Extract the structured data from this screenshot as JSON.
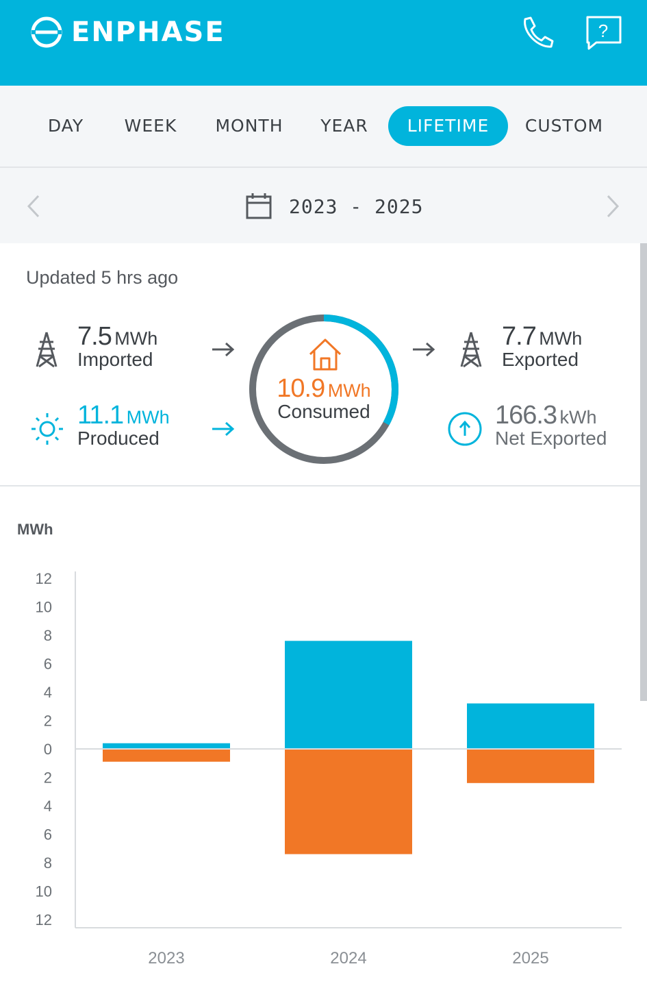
{
  "header": {
    "brand": "ENPHASE",
    "brand_color": "#01b4dc",
    "icons": [
      "enphase-logo-icon",
      "phone-icon",
      "help-icon"
    ],
    "help_glyph": "?"
  },
  "tabs": [
    {
      "label": "DAY",
      "active": false
    },
    {
      "label": "WEEK",
      "active": false
    },
    {
      "label": "MONTH",
      "active": false
    },
    {
      "label": "YEAR",
      "active": false
    },
    {
      "label": "LIFETIME",
      "active": true
    },
    {
      "label": "CUSTOM",
      "active": false
    }
  ],
  "date_range": {
    "label": "2023 - 2025",
    "icons": [
      "chevron-left-icon",
      "calendar-icon",
      "chevron-right-icon"
    ]
  },
  "summary": {
    "updated": "Updated 5 hrs ago",
    "imported": {
      "value": "7.5",
      "unit": "MWh",
      "label": "Imported"
    },
    "produced": {
      "value": "11.1",
      "unit": "MWh",
      "label": "Produced"
    },
    "consumed": {
      "value": "10.9",
      "unit": "MWh",
      "label": "Consumed"
    },
    "exported": {
      "value": "7.7",
      "unit": "MWh",
      "label": "Exported"
    },
    "net_exported": {
      "value": "166.3",
      "unit": "kWh",
      "label": "Net Exported"
    },
    "ring_solar_fraction": 0.33
  },
  "colors": {
    "produced": "#01b4dc",
    "consumed": "#f17726",
    "grid": "#6b7075"
  },
  "chart_data": {
    "type": "bar",
    "ylabel": "MWh",
    "categories": [
      "2023",
      "2024",
      "2025"
    ],
    "series": [
      {
        "values": [
          0.4,
          7.6,
          3.2
        ]
      },
      {
        "values": [
          -0.9,
          -7.4,
          -2.4
        ]
      }
    ],
    "ylim": [
      -12,
      12
    ],
    "yticks": [
      "12",
      "10",
      "8",
      "6",
      "4",
      "2",
      "0",
      "2",
      "4",
      "6",
      "8",
      "10",
      "12"
    ]
  }
}
